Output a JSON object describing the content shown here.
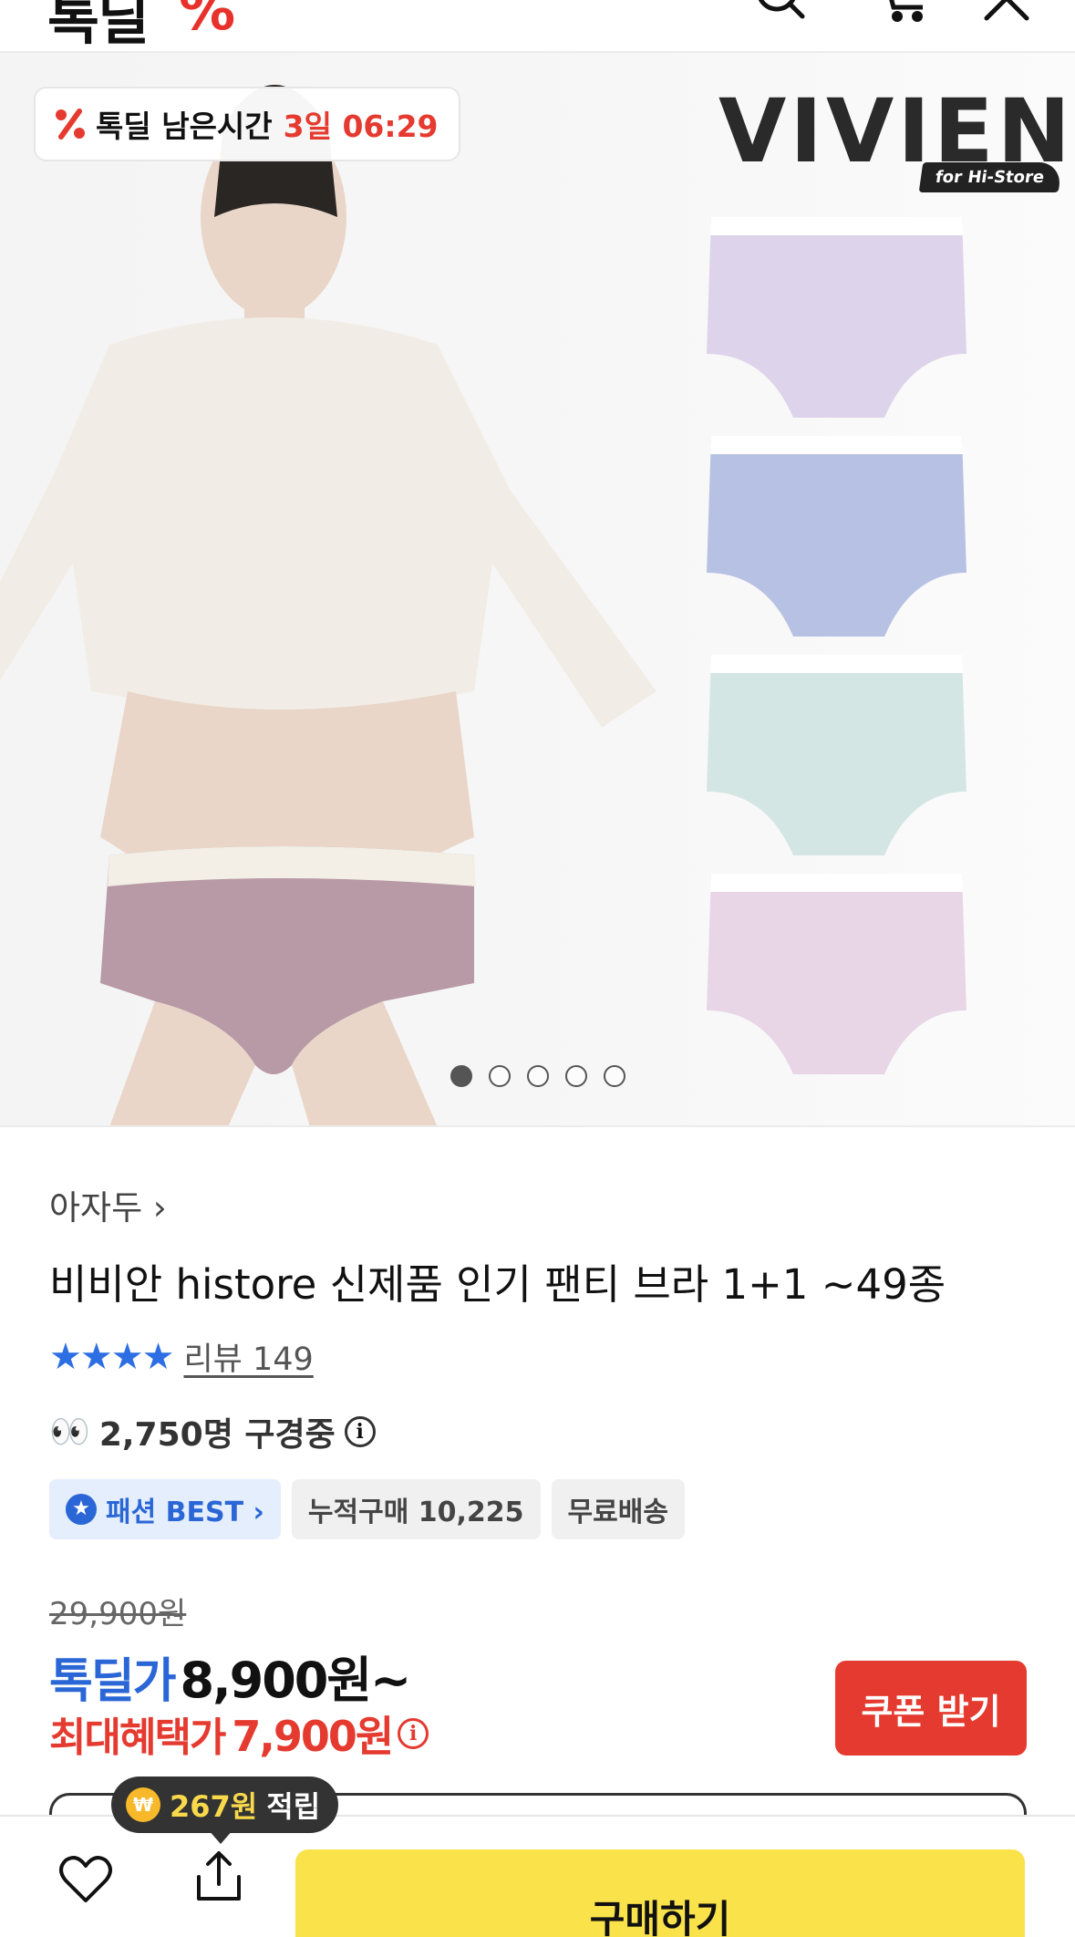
{
  "header": {
    "logo_text": "톡딜",
    "logo_mark": "%",
    "search_icon": "search-icon",
    "cart_icon": "cart-icon",
    "close_icon": "close-icon"
  },
  "hero": {
    "timer_label": "톡딜 남은시간",
    "timer_value": "3일 06:29",
    "brand": "VIVIEN",
    "brand_sub": "for Hi-Store",
    "slides": 5,
    "active_slide": 1
  },
  "product": {
    "seller": "아자두 ›",
    "title": "비비안 histore 신제품 인기 팬티 브라 1+1 ~49종",
    "stars": "★★★★",
    "review_label": "리뷰 149",
    "viewers_emoji": "👀",
    "viewers": "2,750명 구경중",
    "badges": {
      "best": "패션 BEST ›",
      "purchases": "누적구매 10,225",
      "shipping": "무료배송"
    },
    "original_price": "29,900원",
    "price_label": "톡딜가",
    "price": "8,900원~",
    "max_label": "최대혜택가",
    "max_price": "7,900원",
    "coupon_label": "쿠폰 받기"
  },
  "bottom": {
    "points_value": "267원",
    "points_text": "적립",
    "buy_label": "구매하기"
  },
  "colors": {
    "accent_red": "#e53a2f",
    "accent_blue": "#2a66d6",
    "buy_yellow": "#f9e24a"
  }
}
